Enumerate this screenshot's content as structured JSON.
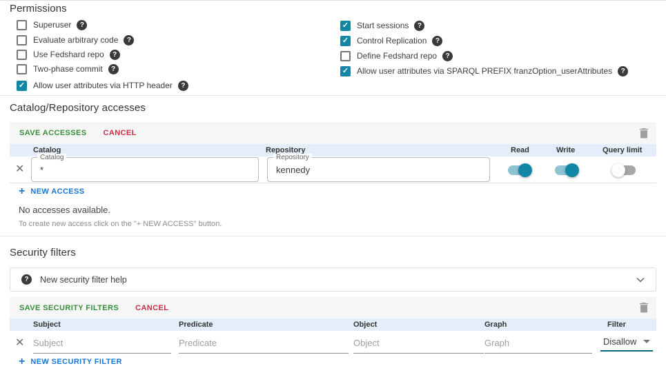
{
  "colors": {
    "accent_teal": "#1287a5",
    "toggle_track_on": "#8ec3d2",
    "toggle_track_off": "#a6a6a6",
    "link_blue": "#1976d2",
    "save_green": "#388e3c",
    "cancel_red": "#c92f42",
    "table_header_bg": "#e4eefa",
    "toolbar_bg": "#f6f6f6"
  },
  "permissions": {
    "title": "Permissions",
    "left": [
      {
        "label": "Superuser",
        "checked": false
      },
      {
        "label": "Evaluate arbitrary code",
        "checked": false
      },
      {
        "label": "Use Fedshard repo",
        "checked": false
      },
      {
        "label": "Two-phase commit",
        "checked": false
      },
      {
        "label": "Allow user attributes via HTTP header",
        "checked": true
      }
    ],
    "right": [
      {
        "label": "Start sessions",
        "checked": true
      },
      {
        "label": "Control Replication",
        "checked": true
      },
      {
        "label": "Define Fedshard repo",
        "checked": false
      },
      {
        "label": "Allow user attributes via SPARQL PREFIX franzOption_userAttributes",
        "checked": true
      }
    ]
  },
  "accesses": {
    "title": "Catalog/Repository accesses",
    "save_label": "SAVE ACCESSES",
    "cancel_label": "CANCEL",
    "columns": {
      "catalog": "Catalog",
      "repository": "Repository",
      "read": "Read",
      "write": "Write",
      "query_limit": "Query limit"
    },
    "row": {
      "catalog_label": "Catalog",
      "catalog_value": "*",
      "repository_label": "Repository",
      "repository_value": "kennedy",
      "read": true,
      "write": true,
      "query_limit": false
    },
    "new_access_label": "NEW ACCESS",
    "empty_text": "No accesses available.",
    "empty_hint": "To create new access click on the \"+ NEW ACCESS\" button."
  },
  "security": {
    "title": "Security filters",
    "help_label": "New security filter help",
    "save_label": "SAVE SECURITY FILTERS",
    "cancel_label": "CANCEL",
    "columns": {
      "subject": "Subject",
      "predicate": "Predicate",
      "object": "Object",
      "graph": "Graph",
      "filter": "Filter"
    },
    "row": {
      "subject_placeholder": "Subject",
      "predicate_placeholder": "Predicate",
      "object_placeholder": "Object",
      "graph_placeholder": "Graph",
      "filter_value": "Disallow"
    },
    "new_filter_label": "NEW SECURITY FILTER"
  }
}
